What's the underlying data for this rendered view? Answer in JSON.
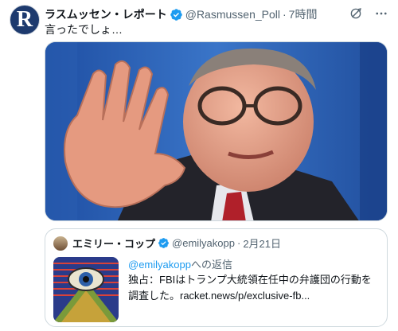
{
  "account": {
    "name": "ラスムッセン・レポート",
    "handle": "@Rasmussen_Poll",
    "time": "7時間",
    "avatar_letter": "R",
    "verified_color": "#1d9bf0"
  },
  "tweet": {
    "text": "言ったでしょ…"
  },
  "icons": [
    "verified-badge-icon",
    "grok-icon",
    "more-icon"
  ],
  "quote": {
    "name": "エミリー・コップ",
    "handle": "@emilyakopp",
    "date": "2月21日",
    "reply_to": "@emilyakopp",
    "reply_suffix": "への返信",
    "text": "独占：FBIはトランプ大統領在任中の弁護団の行動を調査した。racket.news/p/exclusive-fb..."
  }
}
